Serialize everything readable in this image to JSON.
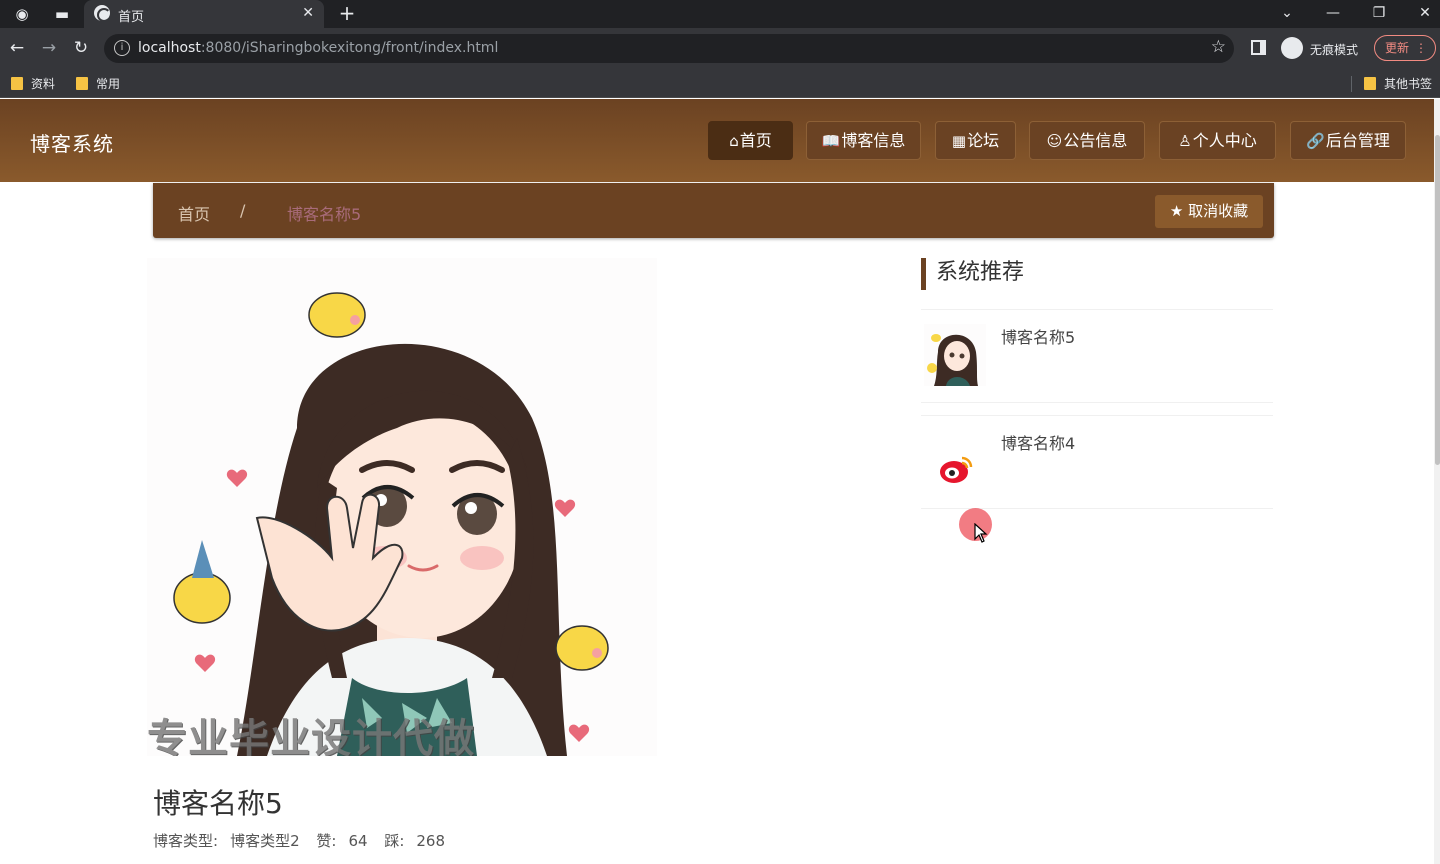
{
  "browser": {
    "tab_title": "首页",
    "url_host": "localhost",
    "url_rest": ":8080/iSharingbokexitong/front/index.html",
    "incognito_label": "无痕模式",
    "update_label": "更新",
    "bookmarks": [
      "资料",
      "常用"
    ],
    "other_bookmarks": "其他书签"
  },
  "site": {
    "logo": "博客系统",
    "nav": [
      {
        "label": "首页",
        "icon": "home-icon"
      },
      {
        "label": "博客信息",
        "icon": "book-icon"
      },
      {
        "label": "论坛",
        "icon": "forum-icon"
      },
      {
        "label": "公告信息",
        "icon": "notice-icon"
      },
      {
        "label": "个人中心",
        "icon": "user-icon"
      },
      {
        "label": "后台管理",
        "icon": "link-icon"
      }
    ]
  },
  "breadcrumb": {
    "home": "首页",
    "separator": "/",
    "current": "博客名称5",
    "favorite_button": "取消收藏"
  },
  "post": {
    "watermark": "专业毕业设计代做",
    "title": "博客名称5",
    "type_label": "博客类型:",
    "type_value": "博客类型2",
    "likes_label": "赞:",
    "likes_value": "64",
    "dislikes_label": "踩:",
    "dislikes_value": "268"
  },
  "sidebar": {
    "heading": "系统推荐",
    "items": [
      {
        "title": "博客名称5"
      },
      {
        "title": "博客名称4"
      }
    ]
  },
  "colors": {
    "header_brown": "#6b4222",
    "nav_active": "#4b2d14",
    "accent_pink": "#a86b7a"
  }
}
